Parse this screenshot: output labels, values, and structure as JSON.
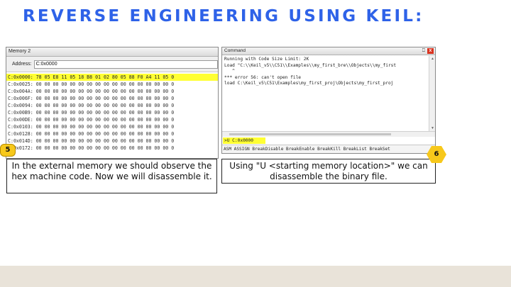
{
  "slide": {
    "title": "REVERSE ENGINEERING USING KEIL:"
  },
  "memory_window": {
    "title": "Memory 2",
    "address_label": "Address:",
    "address_value": "C:0x0000",
    "rows": [
      "C:0x0000: 78 05 E8 11 05 18 B8 01 02 80 05 88 F0 A4 11 05 0",
      "C:0x0025: 00 00 00 00 00 00 00 00 00 00 00 00 00 00 00 00 0",
      "C:0x004A: 00 00 00 00 00 00 00 00 00 00 00 00 00 00 00 00 0",
      "C:0x006F: 00 00 00 00 00 00 00 00 00 00 00 00 00 00 00 00 0",
      "C:0x0094: 00 00 00 00 00 00 00 00 00 00 00 00 00 00 00 00 0",
      "C:0x00B9: 00 00 00 00 00 00 00 00 00 00 00 00 00 00 00 00 0",
      "C:0x00DE: 00 00 00 00 00 00 00 00 00 00 00 00 00 00 00 00 0",
      "C:0x0103: 00 00 00 00 00 00 00 00 00 00 00 00 00 00 00 00 0",
      "C:0x0128: 00 00 00 00 00 00 00 00 00 00 00 00 00 00 00 00 0",
      "C:0x014D: 00 00 00 00 00 00 00 00 00 00 00 00 00 00 00 00 0",
      "C:0x0172: 00 00 00 00 00 00 00 00 00 00 00 00 00 00 00 00 0"
    ]
  },
  "command_window": {
    "title": "Command",
    "pin_glyph": "⎕",
    "close_glyph": "x",
    "output_lines": [
      "Running with Code Size Limit: 2K",
      "Load \"C:\\\\Keil_v5\\\\C51\\\\Examples\\\\my_first_bre\\\\Objects\\\\my_first",
      "   ^",
      "*** error 56: can't open file",
      "load C:\\Keil_v5\\C51\\Examples\\my_first_proj\\Objects\\my_first_proj"
    ],
    "input_value": ">U C:0x0000",
    "hints": "ASM ASSIGN BreakDisable BreakEnable BreakKill BreakList BreakSet"
  },
  "captions": {
    "left": "In the external memory we should observe the hex machine code. Now we will disassemble it.",
    "right": "Using \"U <starting memory location>\" we can disassemble the binary file."
  },
  "badges": {
    "left": "5",
    "right": "6"
  },
  "colors": {
    "title_blue": "#2e62e8",
    "highlight_yellow": "#ffff33",
    "badge_yellow": "#f7c81b",
    "footer_band": "#e9e3d9"
  }
}
